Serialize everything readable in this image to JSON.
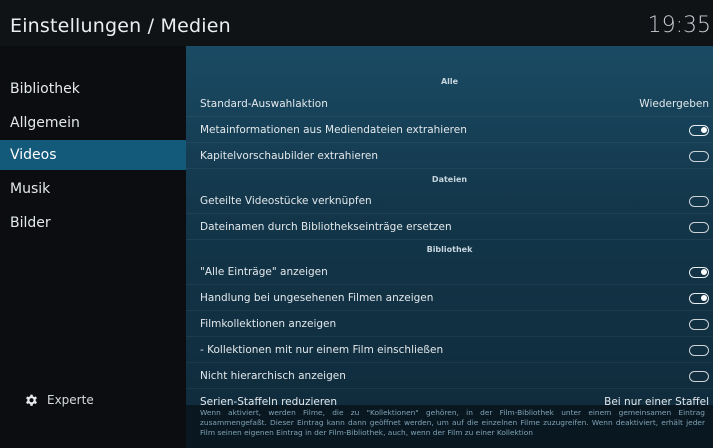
{
  "header": {
    "title": "Einstellungen / Medien",
    "clock": "19:35"
  },
  "sidebar": {
    "items": [
      {
        "label": "Bibliothek",
        "active": false
      },
      {
        "label": "Allgemein",
        "active": false
      },
      {
        "label": "Videos",
        "active": true
      },
      {
        "label": "Musik",
        "active": false
      },
      {
        "label": "Bilder",
        "active": false
      }
    ],
    "level_label": "Experte",
    "level_icon": "gear-icon"
  },
  "settings": {
    "sections": [
      {
        "title": "Alle"
      },
      {
        "title": "Dateien"
      },
      {
        "title": "Bibliothek"
      }
    ],
    "rows": [
      {
        "label": "Standard-Auswahlaktion",
        "value": "Wiedergeben"
      },
      {
        "label": "Metainformationen aus Mediendateien extrahieren",
        "toggle": true
      },
      {
        "label": "Kapitelvorschaubilder extrahieren",
        "toggle": false
      },
      {
        "label": "Geteilte Videostücke verknüpfen",
        "toggle": false
      },
      {
        "label": "Dateinamen durch Bibliothekseinträge ersetzen",
        "toggle": false
      },
      {
        "label": "\"Alle Einträge\" anzeigen",
        "toggle": true
      },
      {
        "label": "Handlung bei ungesehenen Filmen anzeigen",
        "toggle": true
      },
      {
        "label": "Filmkollektionen anzeigen",
        "toggle": false
      },
      {
        "label": "- Kollektionen mit nur einem Film einschließen",
        "toggle": false
      },
      {
        "label": "Nicht hierarchisch anzeigen",
        "toggle": false
      },
      {
        "label": "Serien-Staffeln reduzieren",
        "value": "Bei nur einer Staffel"
      }
    ]
  },
  "description": {
    "text": "Wenn aktiviert, werden Filme, die zu \"Kollektionen\" gehören, in der Film-Bibliothek unter einem gemeinsamen Eintrag zusammengefaßt. Dieser Eintrag kann dann geöffnet werden, um auf die einzelnen Filme zuzugreifen. Wenn deaktiviert, erhält jeder Film seinen eigenen Eintrag in der Film-Bibliothek, auch, wenn der Film zu einer Kollektion"
  },
  "colors": {
    "accent": "#12597a",
    "panel": "#1a4b64"
  }
}
